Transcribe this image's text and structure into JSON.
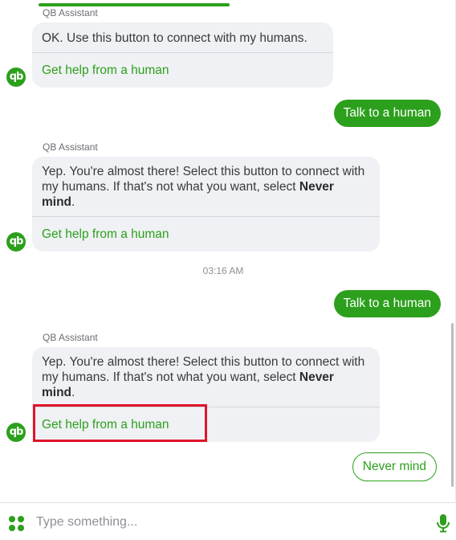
{
  "assistant_name": "QB Assistant",
  "avatar_text": "qb",
  "messages": [
    {
      "type": "bot",
      "text": "OK. Use this button to connect with my humans.",
      "action_label": "Get help from a human"
    },
    {
      "type": "user",
      "text": "Talk to a human"
    },
    {
      "type": "bot",
      "text_before_bold": "Yep. You're almost there!  Select this button to connect with my humans. If that's not what you want, select ",
      "bold_text": "Never mind",
      "text_after_bold": ".",
      "action_label": "Get help from a human"
    },
    {
      "type": "timestamp",
      "text": "03:16 AM"
    },
    {
      "type": "user",
      "text": "Talk to a human"
    },
    {
      "type": "bot",
      "text_before_bold": "Yep. You're almost there!  Select this button to connect with my humans. If that's not what you want, select ",
      "bold_text": "Never mind",
      "text_after_bold": ".",
      "action_label": "Get help from a human"
    }
  ],
  "quick_reply": "Never mind",
  "composer": {
    "placeholder": "Type something..."
  },
  "icons": {
    "avatar": "quickbooks-logo-icon",
    "apps": "grid-dots-icon",
    "voice": "microphone-icon"
  },
  "colors": {
    "brand_green": "#2ca01c",
    "bot_bubble_bg": "#f0f1f4",
    "highlight_red": "#e0142a"
  }
}
